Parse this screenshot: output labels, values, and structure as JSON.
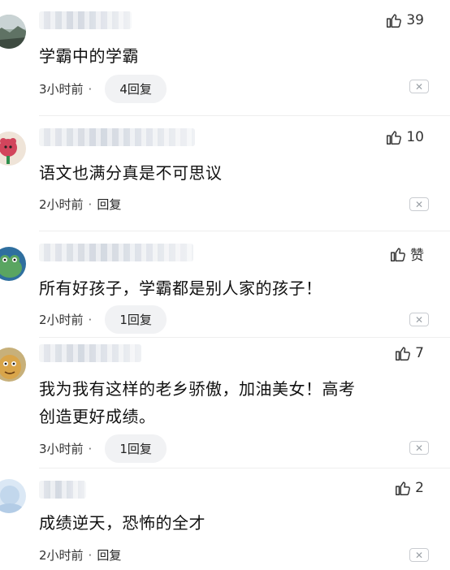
{
  "comments": [
    {
      "text": "学霸中的学霸",
      "likes": "39",
      "time": "3小时前",
      "dot": "·",
      "reply": "4回复",
      "reply_style": "pill",
      "close": "✕",
      "avatar": "landscape"
    },
    {
      "text": "语文也满分真是不可思议",
      "likes": "10",
      "time": "2小时前",
      "dot": "·",
      "reply": "回复",
      "reply_style": "plain",
      "close": "✕",
      "avatar": "pink-creature"
    },
    {
      "text": "所有好孩子，学霸都是别人家的孩子！",
      "likes": "赞",
      "time": "2小时前",
      "dot": "·",
      "reply": "1回复",
      "reply_style": "pill",
      "close": "✕",
      "avatar": "frog"
    },
    {
      "text_lines": [
        "我为我有这样的老乡骄傲，加油美女！高考",
        "创造更好成绩。"
      ],
      "likes": "7",
      "time": "3小时前",
      "dot": "·",
      "reply": "1回复",
      "reply_style": "pill",
      "close": "✕",
      "avatar": "cartoon-face"
    },
    {
      "text": "成绩逆天，恐怖的全才",
      "likes": "2",
      "time": "2小时前",
      "dot": "·",
      "reply": "回复",
      "reply_style": "plain",
      "close": "✕",
      "avatar": "light-blue"
    }
  ],
  "colors": {
    "pill_bg": "#f1f2f4",
    "text": "#111111",
    "meta": "#333333"
  }
}
